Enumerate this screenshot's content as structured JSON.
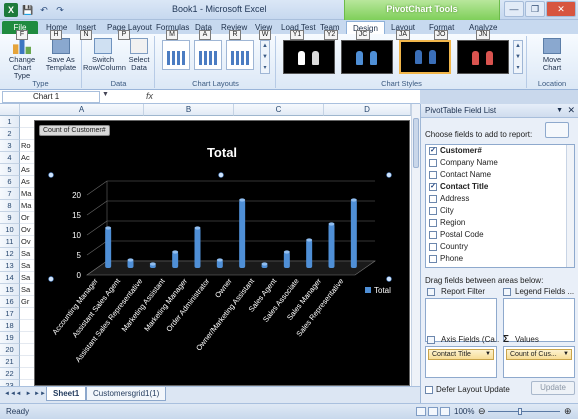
{
  "window": {
    "title": "Book1 - Microsoft Excel",
    "context_title": "PivotChart Tools",
    "minimize": "—",
    "restore": "❐",
    "close": "✕"
  },
  "qat": {
    "app_icon": "X",
    "save": "💾",
    "undo": "↶",
    "redo": "↷"
  },
  "tabs": [
    {
      "label": "File",
      "key": "F"
    },
    {
      "label": "Home",
      "key": "H"
    },
    {
      "label": "Insert",
      "key": "N"
    },
    {
      "label": "Page Layout",
      "key": "P"
    },
    {
      "label": "Formulas",
      "key": "M"
    },
    {
      "label": "Data",
      "key": "A"
    },
    {
      "label": "Review",
      "key": "R"
    },
    {
      "label": "View",
      "key": "W"
    },
    {
      "label": "Load Test",
      "key": "Y1"
    },
    {
      "label": "Team",
      "key": "Y2"
    },
    {
      "label": "Design",
      "key": "JC"
    },
    {
      "label": "Layout",
      "key": "JA"
    },
    {
      "label": "Format",
      "key": "JO"
    },
    {
      "label": "Analyze",
      "key": "JN"
    }
  ],
  "ribbon": {
    "change_chart_type": "Change Chart Type",
    "save_as_template": "Save As Template",
    "group_type": "Type",
    "switch_row_column": "Switch Row/Column",
    "select_data": "Select Data",
    "group_data": "Data",
    "group_chart_layouts": "Chart Layouts",
    "group_chart_styles": "Chart Styles",
    "move_chart": "Move Chart",
    "group_location": "Location"
  },
  "formula_bar": {
    "name_box": "Chart 1",
    "fx": "fx",
    "dropdown": "▼"
  },
  "sheet": {
    "columns": [
      "A",
      "B",
      "C",
      "D"
    ],
    "rows": [
      {
        "num": "1",
        "text": ""
      },
      {
        "num": "2",
        "text": ""
      },
      {
        "num": "3",
        "text": "Ro"
      },
      {
        "num": "4",
        "text": "Ac"
      },
      {
        "num": "5",
        "text": "As"
      },
      {
        "num": "6",
        "text": "As"
      },
      {
        "num": "7",
        "text": "Ma"
      },
      {
        "num": "8",
        "text": "Ma"
      },
      {
        "num": "9",
        "text": "Or"
      },
      {
        "num": "10",
        "text": "Ov"
      },
      {
        "num": "11",
        "text": "Ov"
      },
      {
        "num": "12",
        "text": "Sa"
      },
      {
        "num": "13",
        "text": "Sa"
      },
      {
        "num": "14",
        "text": "Sa"
      },
      {
        "num": "15",
        "text": "Sa"
      },
      {
        "num": "16",
        "text": "Gr"
      },
      {
        "num": "17",
        "text": ""
      },
      {
        "num": "18",
        "text": ""
      },
      {
        "num": "19",
        "text": ""
      },
      {
        "num": "20",
        "text": ""
      },
      {
        "num": "21",
        "text": ""
      },
      {
        "num": "22",
        "text": ""
      },
      {
        "num": "23",
        "text": ""
      }
    ],
    "tabs": [
      {
        "label": "Sheet1"
      },
      {
        "label": "Customersgrid1(1)"
      }
    ],
    "nav": [
      "◄◄",
      "◄",
      "►",
      "►►"
    ]
  },
  "chart_data": {
    "type": "bar",
    "title": "Total",
    "filter_button": "Count of Customer#",
    "legend": [
      "Total"
    ],
    "legend_position": "right",
    "categories": [
      "Accounting Manager",
      "Assistant Sales Agent",
      "Assistant Sales Representative",
      "Marketing Assistant",
      "Marketing Manager",
      "Order Administrator",
      "Owner",
      "Owner/Marketing Assistant",
      "Sales Agent",
      "Sales Associate",
      "Sales Manager",
      "Sales Representative"
    ],
    "values": [
      10,
      2,
      1,
      4,
      10,
      2,
      17,
      1,
      4,
      7,
      11,
      17
    ],
    "ylim": [
      0,
      20
    ],
    "yticks": [
      "0",
      "5",
      "10",
      "15",
      "20"
    ],
    "grid": true,
    "colors": {
      "background": "#000000",
      "bar": "#4f8fd6",
      "grid": "#666666",
      "text": "#ffffff"
    }
  },
  "pane": {
    "title": "PivotTable Field List",
    "choose_label": "Choose fields to add to report:",
    "fields": [
      {
        "label": "Customer#",
        "checked": "✓",
        "bold": true
      },
      {
        "label": "Company Name",
        "checked": "",
        "bold": false
      },
      {
        "label": "Contact Name",
        "checked": "",
        "bold": false
      },
      {
        "label": "Contact Title",
        "checked": "✓",
        "bold": true
      },
      {
        "label": "Address",
        "checked": "",
        "bold": false
      },
      {
        "label": "City",
        "checked": "",
        "bold": false
      },
      {
        "label": "Region",
        "checked": "",
        "bold": false
      },
      {
        "label": "Postal Code",
        "checked": "",
        "bold": false
      },
      {
        "label": "Country",
        "checked": "",
        "bold": false
      },
      {
        "label": "Phone",
        "checked": "",
        "bold": false
      }
    ],
    "drag_label": "Drag fields between areas below:",
    "report_filter": "Report Filter",
    "legend_fields": "Legend Fields ...",
    "axis_fields": "Axis Fields (Ca...",
    "values": "Values",
    "axis_chip": "Contact Title",
    "values_chip": "Count of Cus...",
    "defer_label": "Defer Layout Update",
    "update_label": "Update"
  },
  "status": {
    "ready": "Ready",
    "zoom": "100%",
    "minus": "⊖",
    "plus": "⊕"
  }
}
